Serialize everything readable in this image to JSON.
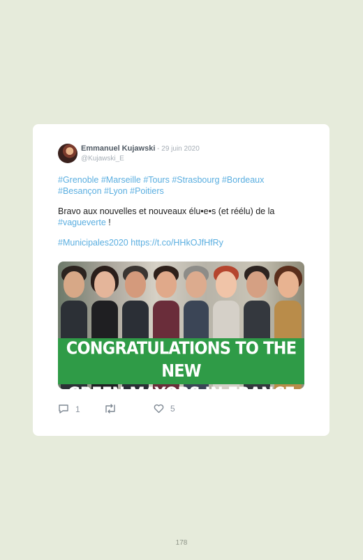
{
  "tweet": {
    "author_name": "Emmanuel Kujawski",
    "separator": " - ",
    "date": "29 juin 2020",
    "handle": "@Kujawski_E",
    "hashtags_line": [
      {
        "text": "#Grenoble"
      },
      {
        "text": "#Marseille"
      },
      {
        "text": "#Tours"
      },
      {
        "text": "#Strasbourg"
      },
      {
        "text": "#Bordeaux"
      },
      {
        "text": "#Besançon"
      },
      {
        "text": "#Lyon"
      },
      {
        "text": "#Poitiers"
      }
    ],
    "body_text": "Bravo aux nouvelles et nouveaux élu•e•s (et réélu) de la",
    "body_link": "#vagueverte",
    "body_end": " !",
    "footer_hashtag": "#Municipales2020",
    "footer_url": "https://t.co/HHkOJfHfRy",
    "media": {
      "banner_line1": "CONGRATULATIONS TO THE NEW",
      "banner_line2": "GREEN MAYORS IN FRANCE"
    },
    "actions": {
      "reply_icon": "reply-icon",
      "reply_count": "1",
      "retweet_icon": "retweet-icon",
      "retweet_count": "",
      "like_icon": "heart-icon",
      "like_count": "5"
    }
  },
  "page_number": "178",
  "colors": {
    "background": "#e6ebdb",
    "card": "#ffffff",
    "link": "#5aaee0",
    "banner": "#2f9b47"
  }
}
